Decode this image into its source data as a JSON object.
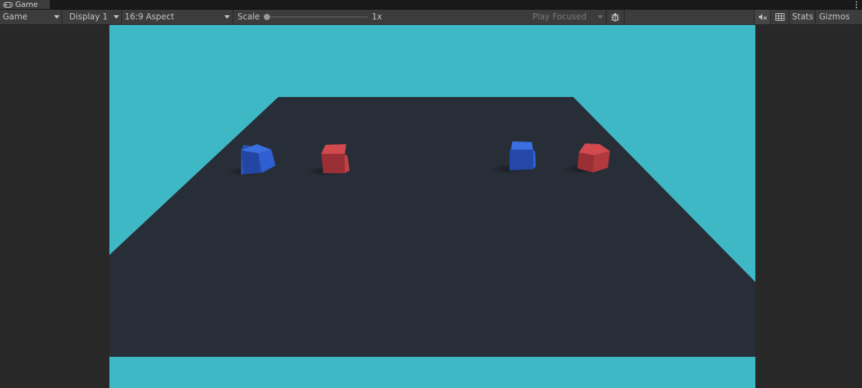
{
  "tab": {
    "label": "Game",
    "icon": "gamepad-icon"
  },
  "toolbar": {
    "view_mode": "Game",
    "display": "Display 1",
    "aspect": "16:9 Aspect",
    "scale_label": "Scale",
    "scale_value": "1x",
    "play_mode": "Play Focused",
    "stats": "Stats",
    "gizmos": "Gizmos"
  },
  "scene": {
    "sky_color": "#3fb8c6",
    "ground_color": "#282e37",
    "cube_colors": [
      "#2f5fd0",
      "#c24146",
      "#2f5fd0",
      "#c24146"
    ]
  }
}
